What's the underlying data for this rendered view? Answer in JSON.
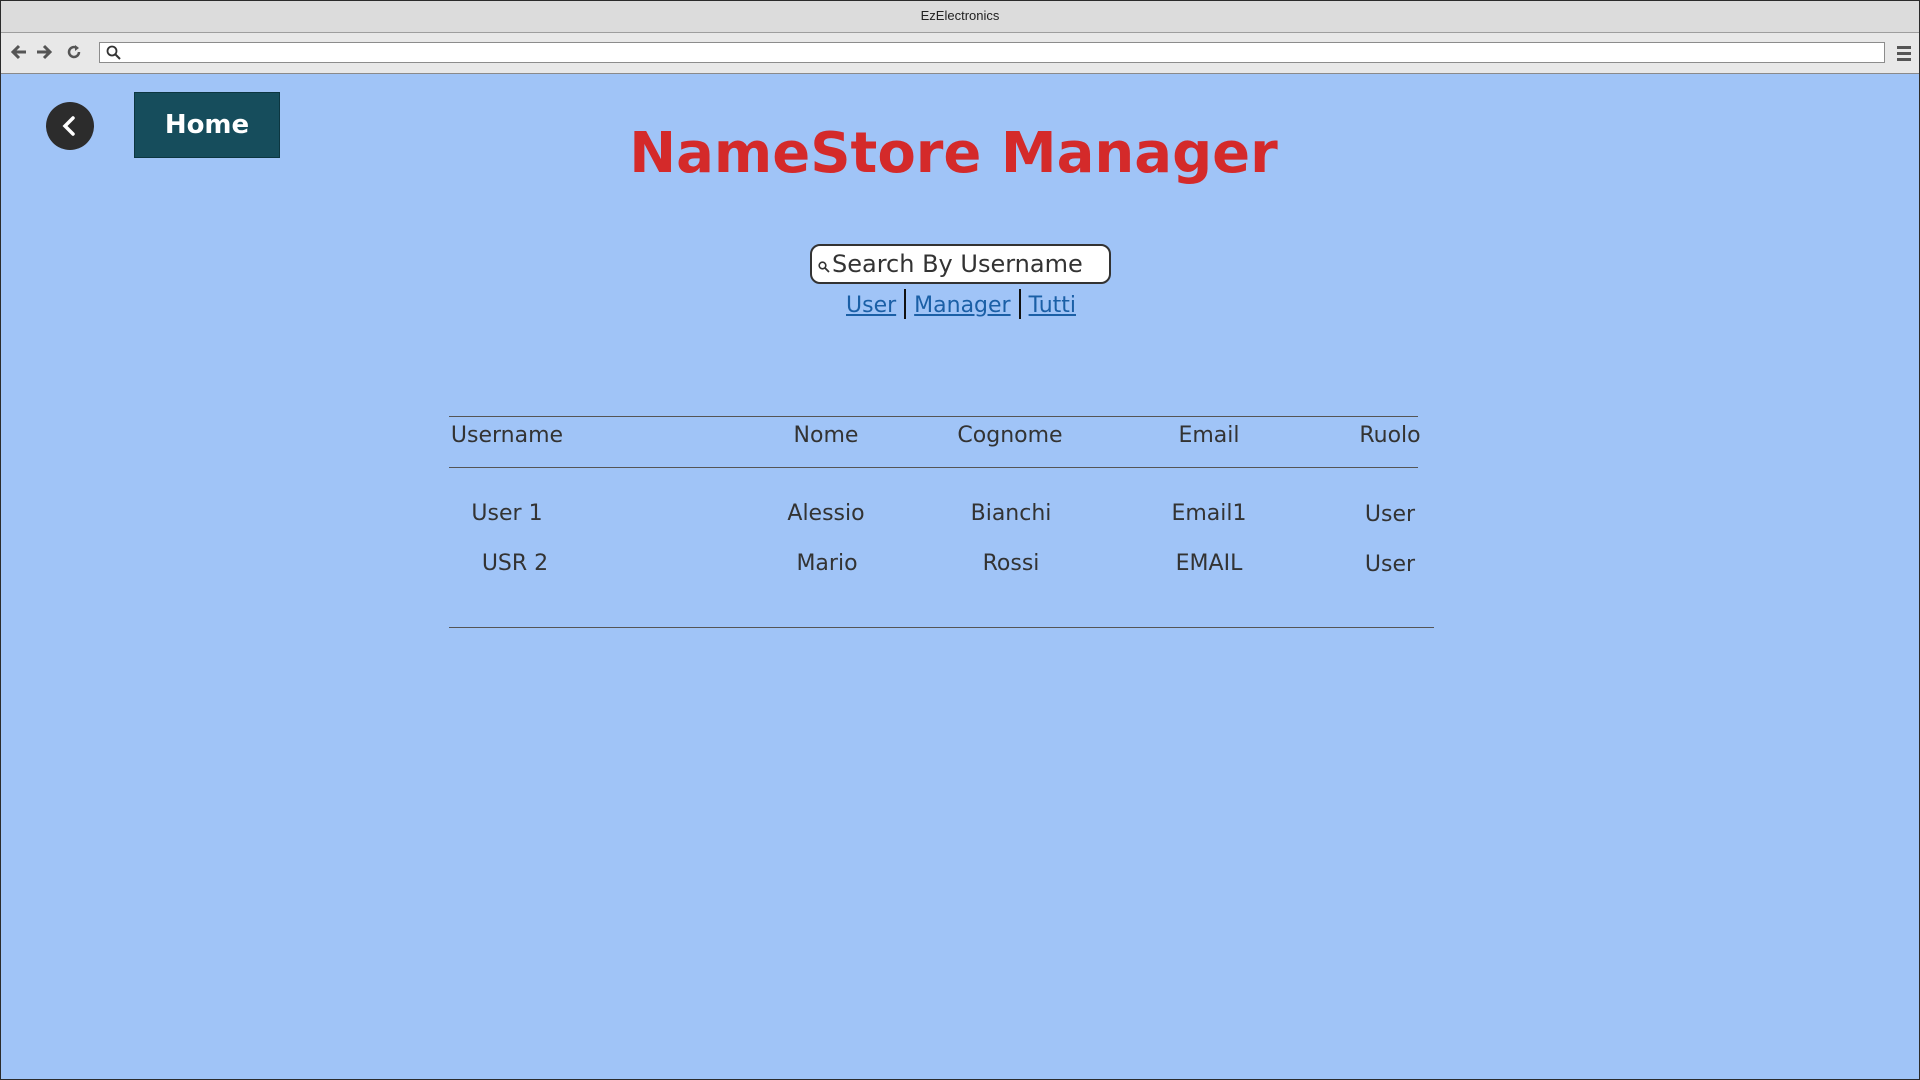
{
  "window": {
    "title": "EzElectronics"
  },
  "browser": {
    "back_icon": "arrow-left-icon",
    "forward_icon": "arrow-right-icon",
    "reload_icon": "reload-icon",
    "url": "",
    "menu_icon": "hamburger-menu-icon"
  },
  "header": {
    "back_button_icon": "chevron-left-icon",
    "home_label": "Home",
    "title": "NameStore Manager",
    "title_color": "#d42a2a"
  },
  "search": {
    "placeholder": "Search By Username",
    "value": ""
  },
  "filters": {
    "user": "User",
    "manager": "Manager",
    "tutti": "Tutti"
  },
  "table": {
    "columns": [
      "Username",
      "Nome",
      "Cognome",
      "Email",
      "Ruolo"
    ],
    "rows": [
      [
        "User 1",
        "Alessio",
        "Bianchi",
        "Email1",
        "User"
      ],
      [
        "USR 2",
        "Mario",
        "Rossi",
        "EMAIL",
        "User"
      ]
    ]
  },
  "colors": {
    "background": "#a0c4f7",
    "home_button": "#164d5c",
    "link": "#1a5fa6"
  }
}
